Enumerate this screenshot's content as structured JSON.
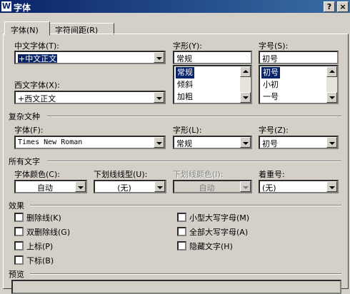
{
  "window": {
    "title": "字体",
    "app_icon": "w-icon",
    "help_label": "?",
    "close_label": "×"
  },
  "tabs": [
    {
      "label": "字体(N)"
    },
    {
      "label": "字符间距(R)"
    }
  ],
  "chinese_font": {
    "label": "中文字体(T):",
    "value": "+中文正文"
  },
  "font_style": {
    "label": "字形(Y):",
    "value": "常规",
    "options": [
      "常规",
      "倾斜",
      "加粗"
    ]
  },
  "font_size": {
    "label": "字号(S):",
    "value": "初号",
    "options": [
      "初号",
      "小初",
      "一号"
    ]
  },
  "western_font": {
    "label": "西文字体(X):",
    "value": "+西文正文"
  },
  "complex_script": {
    "heading": "复杂文种",
    "font": {
      "label": "字体(F):",
      "value": "Times New Roman"
    },
    "style": {
      "label": "字形(L):",
      "value": "常规"
    },
    "size": {
      "label": "字号(Z):",
      "value": "初号"
    }
  },
  "all_text": {
    "heading": "所有文字",
    "font_color": {
      "label": "字体颜色(C):",
      "value": "自动"
    },
    "underline_type": {
      "label": "下划线线型(U):",
      "value": "(无)"
    },
    "underline_color": {
      "label": "下划线颜色(I):",
      "value": "自动"
    },
    "emphasis_mark": {
      "label": "着重号:",
      "value": "(无)"
    }
  },
  "effects": {
    "heading": "效果",
    "items": [
      {
        "label": "删除线(K)"
      },
      {
        "label": "双删除线(G)"
      },
      {
        "label": "上标(P)"
      },
      {
        "label": "下标(B)"
      },
      {
        "label": "小型大写字母(M)"
      },
      {
        "label": "全部大写字母(A)"
      },
      {
        "label": "隐藏文字(H)"
      }
    ]
  },
  "preview": {
    "heading": "预览"
  }
}
